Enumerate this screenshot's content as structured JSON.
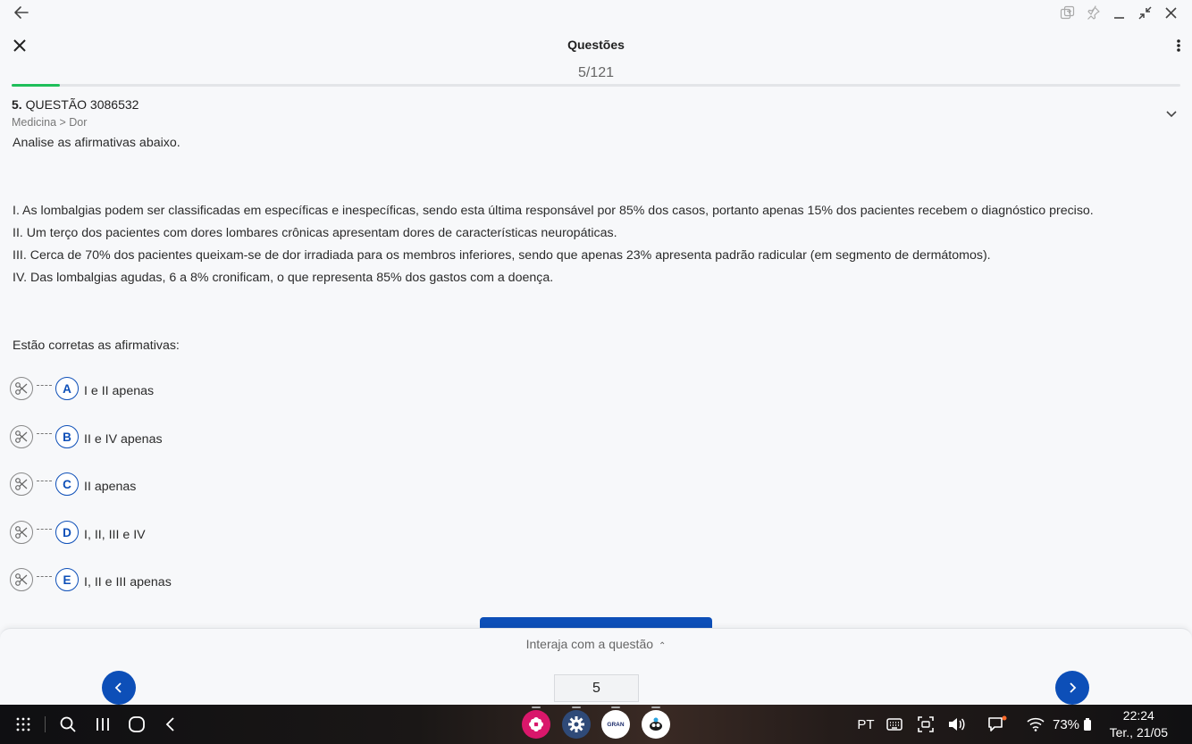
{
  "app": {
    "title": "Questões",
    "counter": "5/121",
    "progress": 0.041
  },
  "question": {
    "number": "5.",
    "label": "QUESTÃO 3086532",
    "breadcrumb": "Medicina > Dor",
    "intro": "Analise as afirmativas abaixo.",
    "statements": [
      "I. As lombalgias podem ser classificadas em específicas e inespecíficas, sendo esta última responsável por 85% dos casos, portanto apenas 15% dos pacientes recebem o diagnóstico preciso.",
      "II. Um terço dos pacientes com dores lombares crônicas apresentam dores de características neuropáticas.",
      "III. Cerca de 70% dos pacientes queixam-se de dor irradiada para os membros inferiores, sendo que apenas 23% apresenta padrão radicular (em segmento de dermátomos).",
      "IV. Das lombalgias agudas, 6 a 8% cronificam, o que representa 85% dos gastos com a doença."
    ],
    "prompt": "Estão corretas as afirmativas:",
    "options": [
      {
        "letter": "A",
        "text": "I e II apenas"
      },
      {
        "letter": "B",
        "text": "II e IV apenas"
      },
      {
        "letter": "C",
        "text": "II apenas"
      },
      {
        "letter": "D",
        "text": "I, II, III e IV"
      },
      {
        "letter": "E",
        "text": "I, II e III apenas"
      }
    ]
  },
  "bottom": {
    "interact_label": "Interaja com a questão",
    "page_value": "5"
  },
  "taskbar": {
    "language": "PT",
    "battery": "73%",
    "time": "22:24",
    "date": "Ter., 21/05",
    "gran_label": "GRAN"
  },
  "colors": {
    "accent": "#0d4fb8",
    "progress": "#1fbf5a"
  }
}
